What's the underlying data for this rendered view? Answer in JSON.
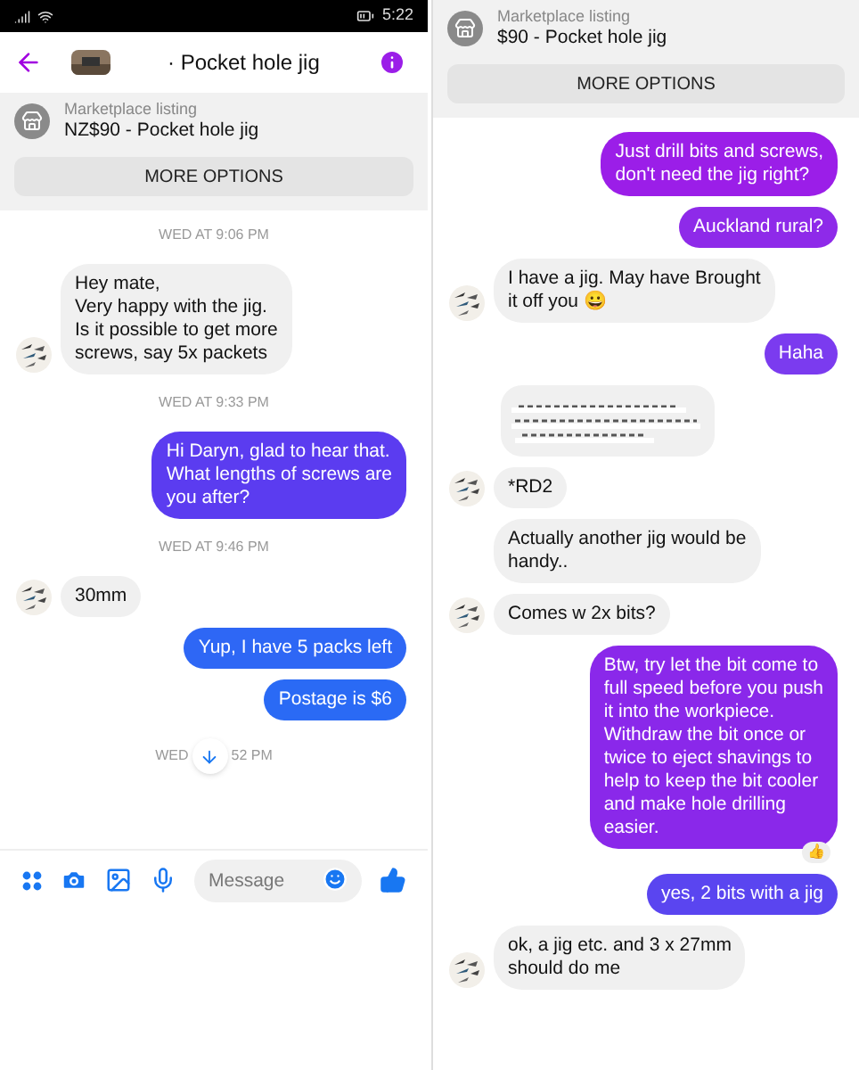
{
  "left": {
    "status_bar": {
      "time": "5:22"
    },
    "header": {
      "title": "· Pocket hole jig"
    },
    "listing": {
      "label": "Marketplace listing",
      "title": "NZ$90 - Pocket hole jig",
      "button": "MORE OPTIONS"
    },
    "messages": [
      {
        "kind": "time",
        "text": "WED AT 9:06 PM"
      },
      {
        "kind": "incoming",
        "text": "Hey mate,\nVery happy with the jig.\nIs it possible to get more\nscrews, say 5x packets",
        "avatar": true
      },
      {
        "kind": "time",
        "text": "WED AT 9:33 PM"
      },
      {
        "kind": "outgoing",
        "text": "Hi Daryn, glad to hear that.\nWhat lengths of screws are\nyou after?",
        "color": "#5b3cf0"
      },
      {
        "kind": "time",
        "text": "WED AT 9:46 PM"
      },
      {
        "kind": "incoming",
        "text": "30mm",
        "avatar": true
      },
      {
        "kind": "outgoing",
        "text": "Yup, I have 5 packs left",
        "color": "#2e67f5"
      },
      {
        "kind": "outgoing",
        "text": "Postage is $6",
        "color": "#2a6af5"
      },
      {
        "kind": "time_covered",
        "before": "WED",
        "after": "52 PM"
      }
    ],
    "composer": {
      "placeholder": "Message"
    }
  },
  "right": {
    "listing": {
      "label": "Marketplace listing",
      "title": "$90 - Pocket hole jig",
      "button": "MORE OPTIONS"
    },
    "messages": [
      {
        "kind": "outgoing",
        "text": "Just drill bits and screws,\ndon't need the jig right?",
        "color": "#9b1ee8"
      },
      {
        "kind": "outgoing",
        "text": "Auckland rural?",
        "color": "#8e2ae9"
      },
      {
        "kind": "incoming",
        "text": "I have a jig. May have Brought\nit off you 😀",
        "avatar": true
      },
      {
        "kind": "outgoing",
        "text": "Haha",
        "color": "#7b3bef"
      },
      {
        "kind": "redacted"
      },
      {
        "kind": "incoming",
        "text": "*RD2",
        "avatar": true
      },
      {
        "kind": "incoming",
        "text": "Actually another jig would be\nhandy..",
        "avatar": false
      },
      {
        "kind": "incoming",
        "text": "Comes w 2x bits?",
        "avatar": true
      },
      {
        "kind": "outgoing",
        "text": "Btw, try let the bit come to\nfull speed before you push\nit into the workpiece.\nWithdraw the bit once or\ntwice to eject shavings to\nhelp to keep the bit cooler\nand make hole drilling\neasier.",
        "color": "#8a28ea",
        "reaction": "👍"
      },
      {
        "kind": "outgoing",
        "text": "yes, 2 bits with a jig",
        "color": "#5a45f0"
      },
      {
        "kind": "incoming",
        "text": "ok, a jig etc. and 3 x 27mm\nshould do me",
        "avatar": true
      }
    ]
  }
}
